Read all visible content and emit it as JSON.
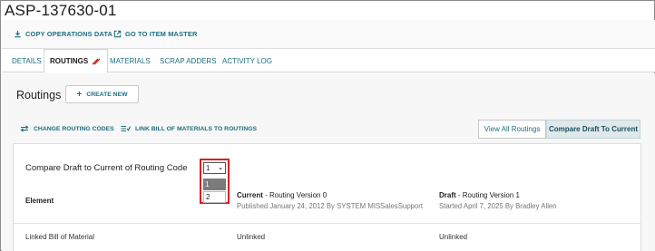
{
  "header": {
    "part_number": "ASP-137630-01"
  },
  "top_actions": {
    "copy_operations": "COPY OPERATIONS DATA",
    "go_to_item_master": "GO TO ITEM MASTER"
  },
  "tabs": [
    {
      "label": "DETAILS"
    },
    {
      "label": "ROUTINGS"
    },
    {
      "label": "MATERIALS"
    },
    {
      "label": "SCRAP ADDERS"
    },
    {
      "label": "ACTIVITY LOG"
    }
  ],
  "routings": {
    "title": "Routings",
    "create_new": "CREATE NEW",
    "change_routing_codes": "CHANGE ROUTING CODES",
    "link_bom": "LINK BILL OF MATERIALS TO ROUTINGS",
    "view_all": "View All Routings",
    "compare_draft": "Compare Draft To Current"
  },
  "compare": {
    "label": "Compare Draft to Current of Routing Code",
    "selected": "1",
    "options": [
      "1",
      "2"
    ]
  },
  "table": {
    "element_header": "Element",
    "current": {
      "title": "Current",
      "subtitle": " - Routing Version 0",
      "meta": "Published January 24, 2012 By SYSTEM MISSalesSupport"
    },
    "draft": {
      "title": "Draft",
      "subtitle": " - Routing Version 1",
      "meta": "Started April 7, 2025 By Bradley Allen"
    },
    "rows": [
      {
        "element": "Linked Bill of Material",
        "current": "Unlinked",
        "draft": "Unlinked"
      }
    ]
  },
  "colors": {
    "accent": "#1e6f82",
    "highlight_border": "#d9201f",
    "toggle_active_bg": "#dfe9ec"
  }
}
